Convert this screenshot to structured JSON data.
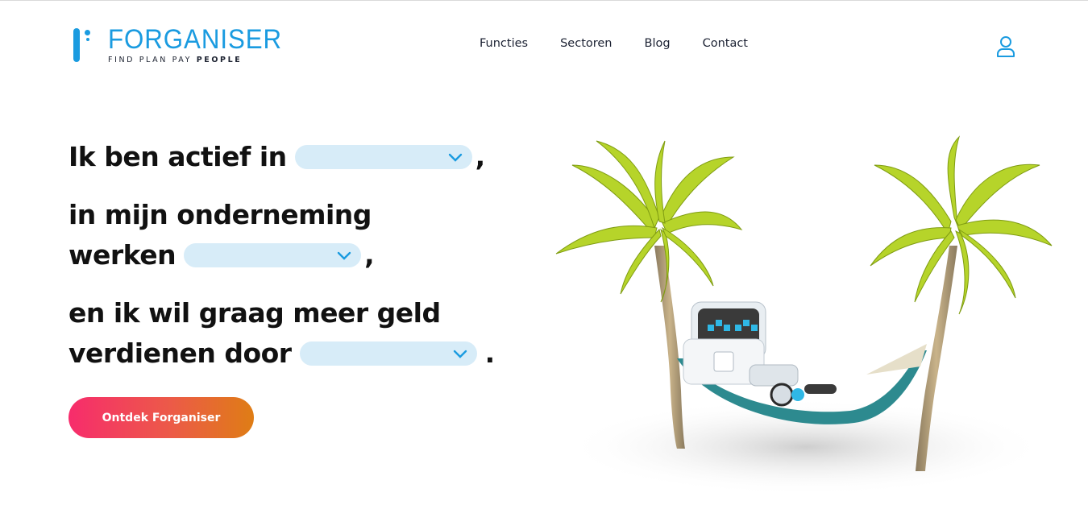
{
  "brand": {
    "name": "FORGANISER",
    "tagline_plain": "FIND  PLAN  PAY ",
    "tagline_bold": "PEOPLE",
    "color": "#1a9be0"
  },
  "nav": {
    "items": [
      "Functies",
      "Sectoren",
      "Blog",
      "Contact"
    ]
  },
  "header": {
    "user_icon": "user-icon"
  },
  "hero": {
    "line1": "Ik ben actief in",
    "line1_end": ",",
    "line2": "in mijn onderneming",
    "line3": "werken",
    "line3_end": ",",
    "line4": "en ik wil graag meer geld",
    "line5": "verdienen door",
    "line5_end": ".",
    "select_icon": "chevron-down-icon"
  },
  "cta": {
    "label": "Ontdek Forganiser",
    "gradient": [
      "#f72c6c",
      "#df7d15"
    ]
  },
  "illustration": {
    "description_icon": "robot-hammock-palm-trees-illustration"
  }
}
